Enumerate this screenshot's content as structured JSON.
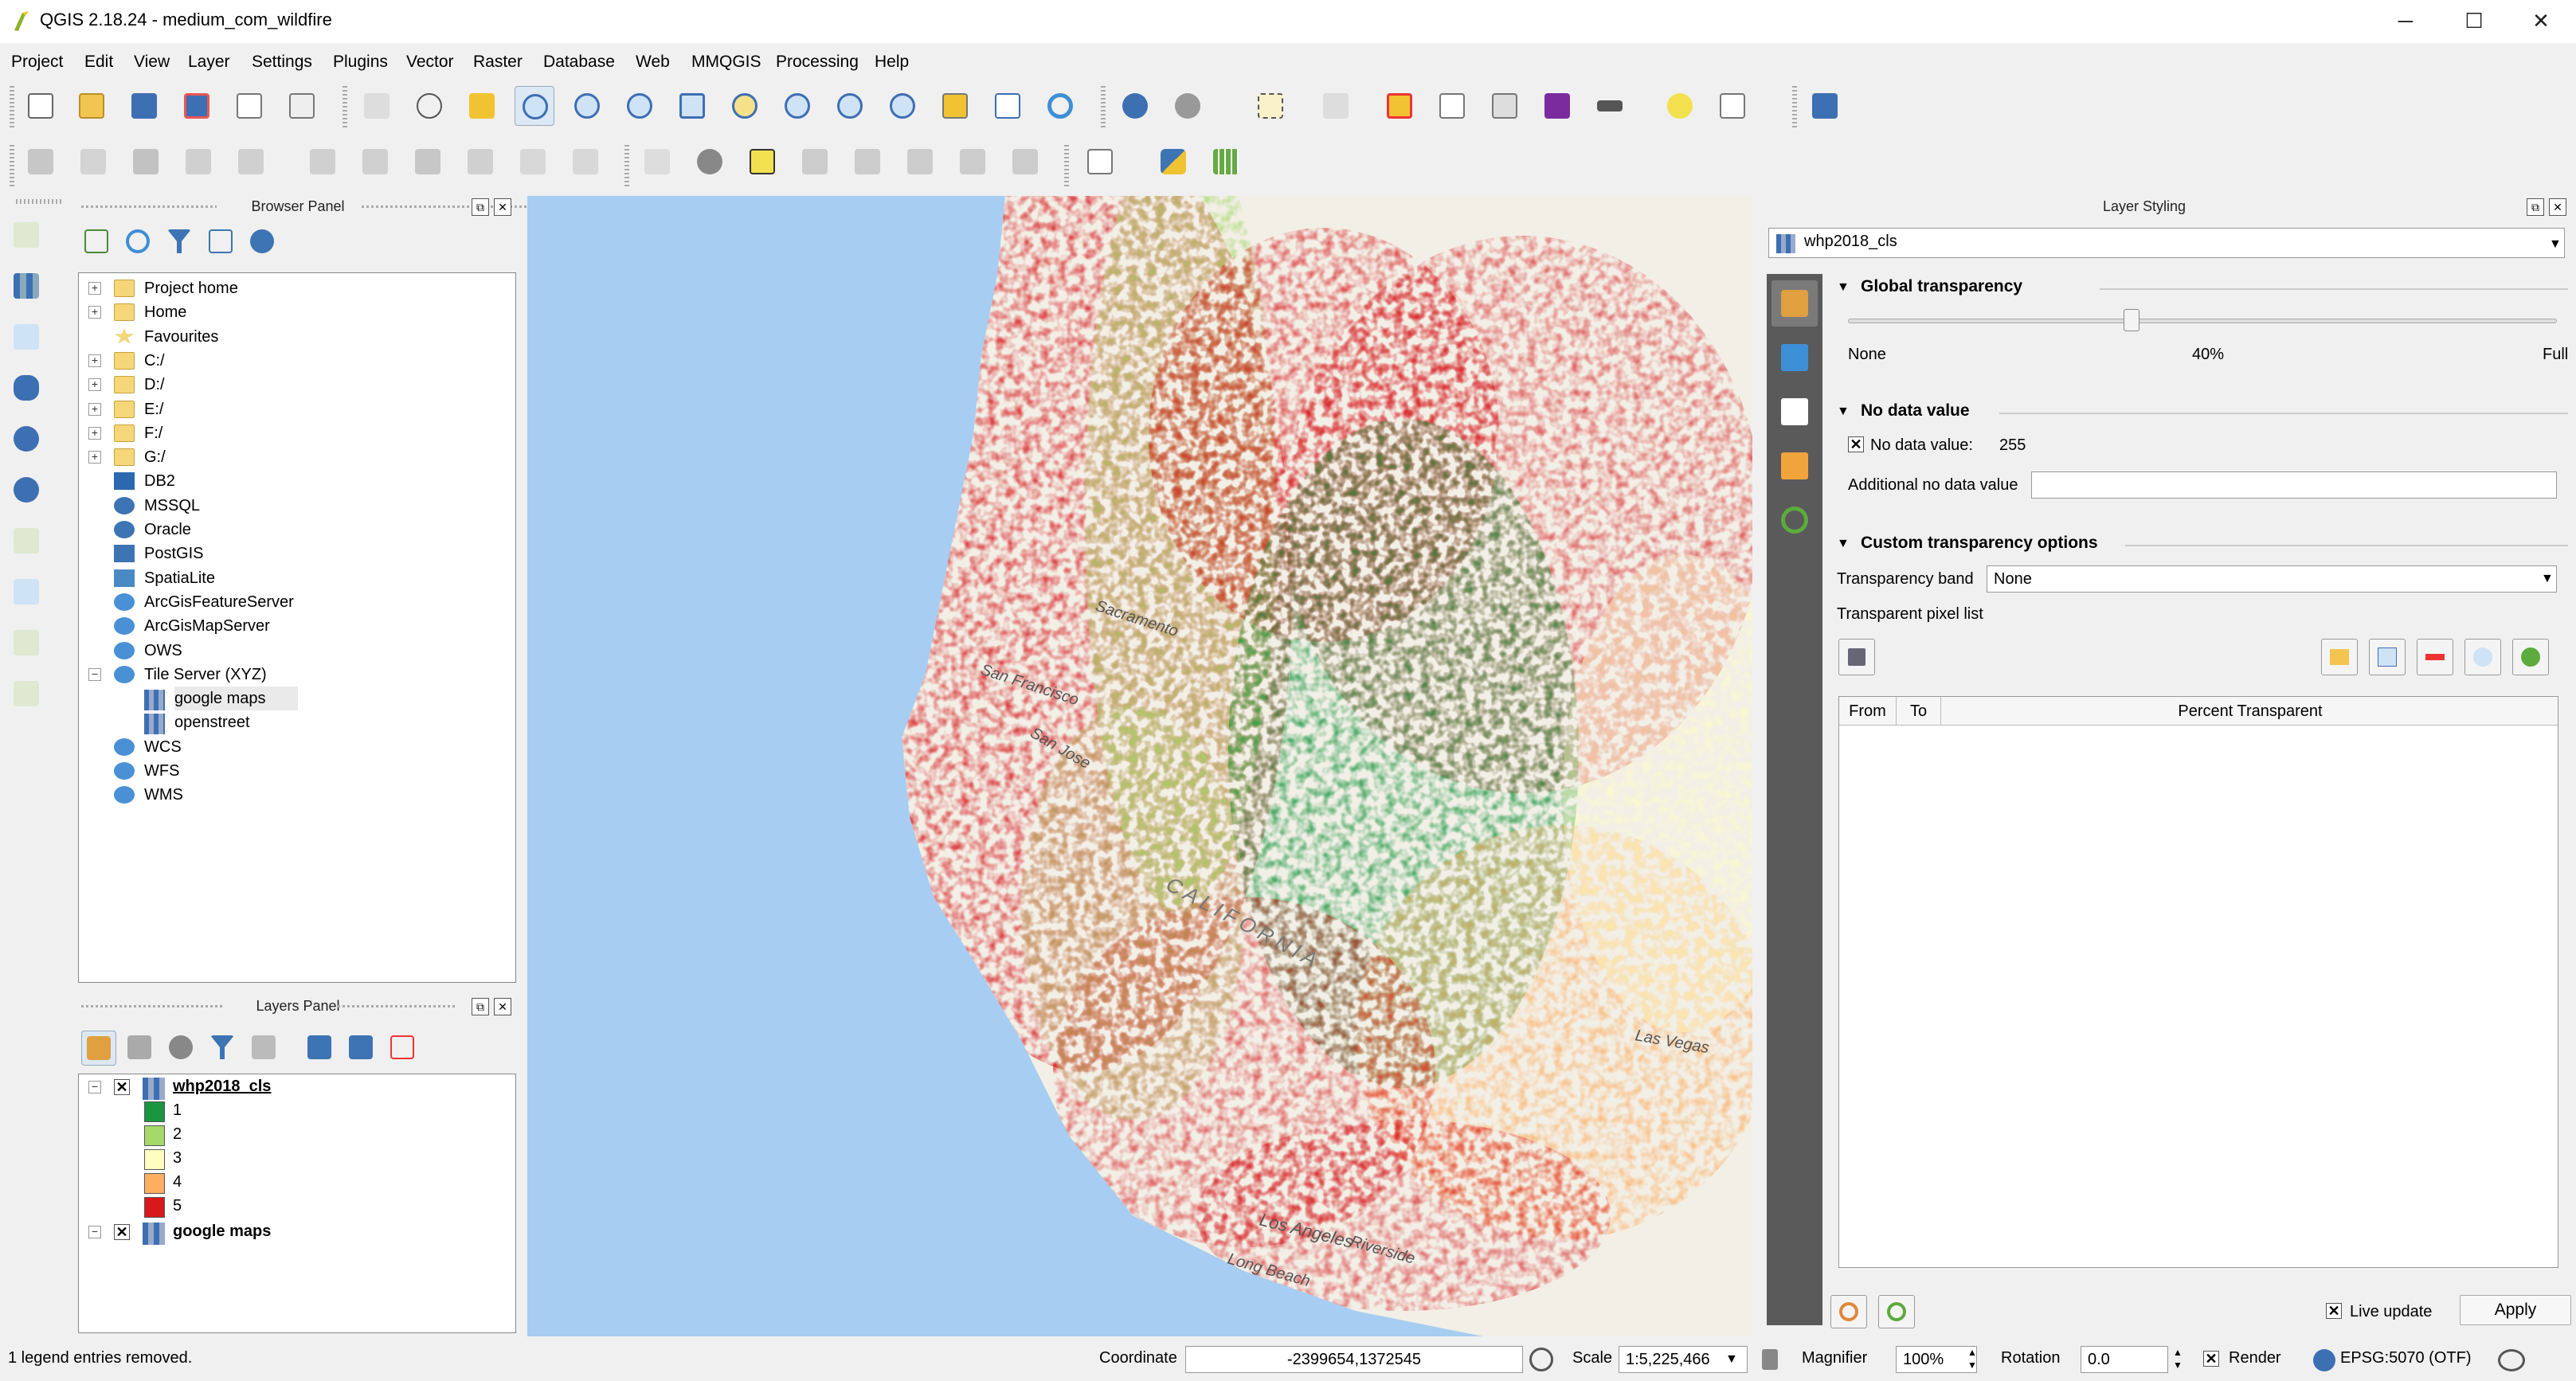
{
  "window": {
    "title": "QGIS 2.18.24 - medium_com_wildfire",
    "min": "─",
    "max": "☐",
    "close": "✕"
  },
  "menu": [
    "Project",
    "Edit",
    "View",
    "Layer",
    "Settings",
    "Plugins",
    "Vector",
    "Raster",
    "Database",
    "Web",
    "MMQGIS",
    "Processing",
    "Help"
  ],
  "browser_panel": {
    "title": "Browser Panel",
    "items": [
      {
        "label": "Project home",
        "icon": "folder-icon",
        "expand": true,
        "indent": 0
      },
      {
        "label": "Home",
        "icon": "folder-icon",
        "expand": true,
        "indent": 0
      },
      {
        "label": "Favourites",
        "icon": "star-icon",
        "expand": false,
        "indent": 0
      },
      {
        "label": "C:/",
        "icon": "folder-icon",
        "expand": true,
        "indent": 0
      },
      {
        "label": "D:/",
        "icon": "folder-icon",
        "expand": true,
        "indent": 0
      },
      {
        "label": "E:/",
        "icon": "folder-icon",
        "expand": true,
        "indent": 0
      },
      {
        "label": "F:/",
        "icon": "folder-icon",
        "expand": true,
        "indent": 0
      },
      {
        "label": "G:/",
        "icon": "folder-icon",
        "expand": true,
        "indent": 0
      },
      {
        "label": "DB2",
        "icon": "db2-icon",
        "expand": false,
        "indent": 0
      },
      {
        "label": "MSSQL",
        "icon": "mssql-icon",
        "expand": false,
        "indent": 0
      },
      {
        "label": "Oracle",
        "icon": "oracle-icon",
        "expand": false,
        "indent": 0
      },
      {
        "label": "PostGIS",
        "icon": "postgis-icon",
        "expand": false,
        "indent": 0
      },
      {
        "label": "SpatiaLite",
        "icon": "spatialite-icon",
        "expand": false,
        "indent": 0
      },
      {
        "label": "ArcGisFeatureServer",
        "icon": "globe-icon",
        "expand": false,
        "indent": 0
      },
      {
        "label": "ArcGisMapServer",
        "icon": "globe-icon",
        "expand": false,
        "indent": 0
      },
      {
        "label": "OWS",
        "icon": "globe-icon",
        "expand": false,
        "indent": 0
      },
      {
        "label": "Tile Server (XYZ)",
        "icon": "globe-icon",
        "expand": true,
        "indent": 0,
        "open": true
      },
      {
        "label": "google maps",
        "icon": "raster-icon",
        "expand": false,
        "indent": 1
      },
      {
        "label": "openstreet",
        "icon": "raster-icon",
        "expand": false,
        "indent": 1
      },
      {
        "label": "WCS",
        "icon": "globe-icon",
        "expand": false,
        "indent": 0
      },
      {
        "label": "WFS",
        "icon": "globe-icon",
        "expand": false,
        "indent": 0
      },
      {
        "label": "WMS",
        "icon": "globe-icon",
        "expand": false,
        "indent": 0
      }
    ]
  },
  "layers_panel": {
    "title": "Layers Panel",
    "layers": [
      {
        "name": "whp2018_cls",
        "checked": "✕",
        "classes": [
          {
            "label": "1",
            "color": "#1a9641"
          },
          {
            "label": "2",
            "color": "#a6d96a"
          },
          {
            "label": "3",
            "color": "#ffffc0"
          },
          {
            "label": "4",
            "color": "#fdae61"
          },
          {
            "label": "5",
            "color": "#d7191c"
          }
        ]
      },
      {
        "name": "google maps",
        "checked": "✕",
        "classes": []
      }
    ]
  },
  "styling": {
    "title": "Layer Styling",
    "layer_select": "whp2018_cls",
    "global_transparency": {
      "header": "Global transparency",
      "min_label": "None",
      "value_label": "40%",
      "max_label": "Full",
      "value": 0.4
    },
    "no_data": {
      "header": "No data value",
      "check_label": "No data value:",
      "value": "255",
      "checked": "✕",
      "additional_label": "Additional no data value",
      "additional_value": ""
    },
    "custom": {
      "header": "Custom transparency options",
      "band_label": "Transparency band",
      "band_value": "None",
      "pixel_list_label": "Transparent pixel list",
      "columns": [
        "From",
        "To",
        "Percent Transparent"
      ]
    },
    "live_update": {
      "label": "Live update",
      "checked": "✕"
    },
    "apply_label": "Apply"
  },
  "status": {
    "message": "1 legend entries removed.",
    "coordinate_label": "Coordinate",
    "coordinate": "-2399654,1372545",
    "scale_label": "Scale",
    "scale": "1:5,225,466",
    "magnifier_label": "Magnifier",
    "magnifier": "100%",
    "rotation_label": "Rotation",
    "rotation": "0.0",
    "render_label": "Render",
    "render_checked": "✕",
    "crs": "EPSG:5070 (OTF)"
  },
  "map_labels": [
    {
      "text": "Sacramento"
    },
    {
      "text": "San Francisco"
    },
    {
      "text": "San Jose"
    },
    {
      "text": "CALIFORNIA"
    },
    {
      "text": "Las Vegas"
    },
    {
      "text": "Los Angeles"
    },
    {
      "text": "Long Beach"
    },
    {
      "text": "Riverside"
    }
  ],
  "colors": {
    "class1": "#1a9641",
    "class2": "#a6d96a",
    "class3": "#ffffc0",
    "class4": "#fdae61",
    "class5": "#d7191c",
    "water": "#a7cdf2",
    "land": "#f2efe6"
  }
}
